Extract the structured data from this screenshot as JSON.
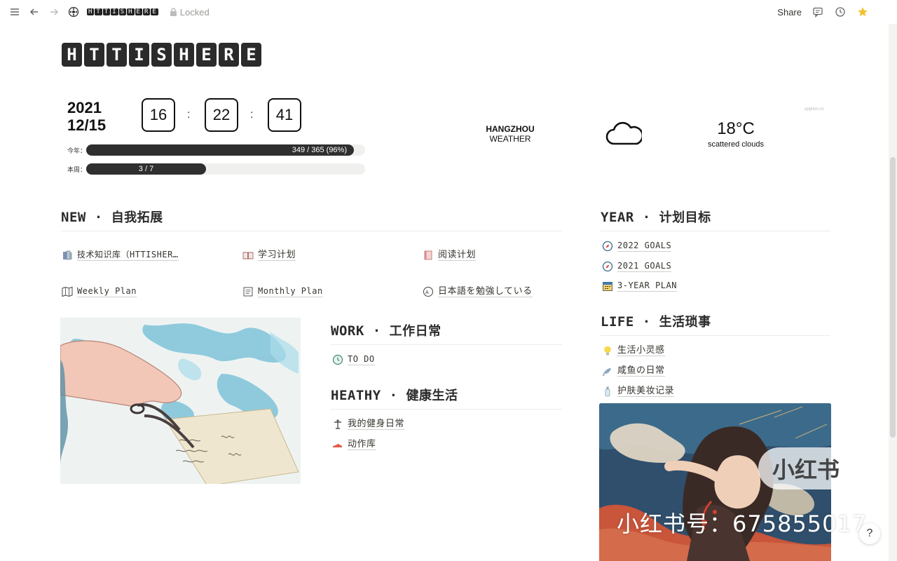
{
  "topbar": {
    "breadcrumb_title": "HTTISHERE",
    "locked_label": "Locked",
    "share_label": "Share"
  },
  "page": {
    "title_letters": [
      "H",
      "T",
      "T",
      "I",
      "S",
      "H",
      "E",
      "R",
      "E"
    ]
  },
  "date": {
    "year": "2021",
    "day": "12/15"
  },
  "clock": {
    "hours": "16",
    "minutes": "22",
    "seconds": "41",
    "sep": ":"
  },
  "progress": {
    "year": {
      "label": "今年：",
      "text": "349 / 365 (96%)",
      "fraction": 0.96
    },
    "week": {
      "label": "本周：",
      "text": "3 / 7",
      "fraction": 0.43
    }
  },
  "weather": {
    "city": "HANGZHOU",
    "caption": "WEATHER",
    "temp": "18°C",
    "desc": "scattered clouds",
    "credit": "apption.co"
  },
  "sections": {
    "new": {
      "en": "NEW",
      "dot": "·",
      "cn": "自我拓展",
      "items": [
        {
          "label": "技术知识库（HTTISHER…",
          "icon": "books-icon"
        },
        {
          "label": "学习计划",
          "icon": "open-book-icon"
        },
        {
          "label": "阅读计划",
          "icon": "notebook-icon"
        },
        {
          "label": "Weekly Plan",
          "icon": "map-icon"
        },
        {
          "label": "Monthly Plan",
          "icon": "memo-icon"
        },
        {
          "label": "日本語を勉強している",
          "icon": "language-icon"
        }
      ]
    },
    "work": {
      "en": "WORK",
      "dot": "·",
      "cn": "工作日常",
      "items": [
        {
          "label": "TO DO",
          "icon": "clock-icon"
        }
      ]
    },
    "heathy": {
      "en": "HEATHY",
      "dot": "·",
      "cn": "健康生活",
      "items": [
        {
          "label": "我的健身日常",
          "icon": "dumbbell-icon"
        },
        {
          "label": "动作库",
          "icon": "shoe-icon"
        }
      ]
    },
    "year": {
      "en": "YEAR",
      "dot": "·",
      "cn": "计划目标",
      "items": [
        {
          "label": "2022 GOALS",
          "icon": "compass-icon"
        },
        {
          "label": "2021 GOALS",
          "icon": "compass-icon"
        },
        {
          "label": "3-YEAR PLAN",
          "icon": "calendar-icon"
        }
      ]
    },
    "life": {
      "en": "LIFE",
      "dot": "·",
      "cn": "生活琐事",
      "items": [
        {
          "label": "生活小灵感",
          "icon": "bulb-icon"
        },
        {
          "label": "咸鱼の日常",
          "icon": "fish-icon"
        },
        {
          "label": "护肤美妆记录",
          "icon": "bottle-icon"
        }
      ]
    }
  },
  "watermark": {
    "logo": "小红书",
    "text": "小红书号：675855017"
  },
  "help_label": "?"
}
